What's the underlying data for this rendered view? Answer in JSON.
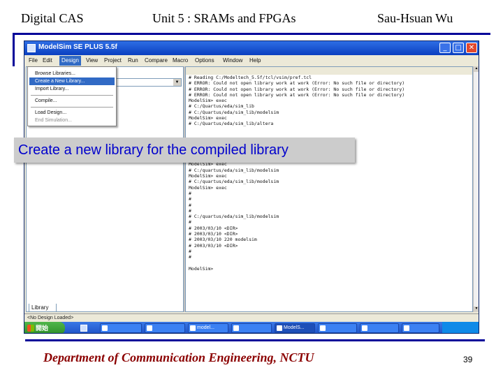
{
  "header": {
    "left": "Digital CAS",
    "center": "Unit 5 : SRAMs and FPGAs",
    "right": "Sau-Hsuan Wu"
  },
  "window": {
    "title": "ModelSim SE PLUS 5.5f",
    "controls": {
      "minimize": "_",
      "maximize": "□",
      "close": "✕"
    }
  },
  "menubar": [
    "File",
    "Edit",
    "Design",
    "View",
    "Project",
    "Run",
    "Compare",
    "Macro",
    "Options",
    "Window",
    "Help"
  ],
  "dropdown": {
    "items": [
      {
        "label": "Browse Libraries...",
        "state": "normal"
      },
      {
        "label": "Create a New Library...",
        "state": "selected"
      },
      {
        "label": "Import Library...",
        "state": "normal"
      },
      {
        "label": "Compile...",
        "state": "normal"
      },
      {
        "label": "Load Design...",
        "state": "normal"
      },
      {
        "label": "End Simulation...",
        "state": "disabled"
      }
    ]
  },
  "left_pane": {
    "tab_label": "Library"
  },
  "transcript": {
    "lines": [
      "# Reading C:/Modeltech_5.5f/tcl/vsim/pref.tcl",
      "# ERROR: Could not open library work at work (Error: No such file or directory)",
      "# ERROR: Could not open library work at work (Error: No such file or directory)",
      "# ERROR: Could not open library work at work (Error: No such file or directory)",
      "ModelSim> exec",
      "# C:/Quartus/eda/sim_lib",
      "# C:/Quartus/eda/sim_lib/modelsim",
      "ModelSim> exec",
      "# C:/Quartus/eda/sim_lib/altera",
      "",
      "",
      "",
      "",
      "",
      "",
      "ModelSim> exec",
      "# C:/quartus/eda/sim_lib/modelsim",
      "ModelSim> exec",
      "# C:/quartus/eda/sim_lib/modelsim",
      "ModelSim> exec",
      "#",
      "#",
      "#",
      "#",
      "# C:/quartus/eda/sim_lib/modelsim",
      "#",
      "# 2003/03/10 <DIR>",
      "# 2003/03/10 <DIR>",
      "# 2003/03/10 220 modelsim",
      "# 2003/03/10 <DIR>",
      "#",
      "#",
      "",
      "ModelSim>"
    ]
  },
  "prompt": "<No Design Loaded>",
  "taskbar": {
    "start_label": "開始",
    "tasks": [
      {
        "label": ""
      },
      {
        "label": ""
      },
      {
        "label": "model..."
      },
      {
        "label": ""
      },
      {
        "label": "ModelS..."
      },
      {
        "label": ""
      },
      {
        "label": ""
      },
      {
        "label": ""
      }
    ],
    "tray": ""
  },
  "callout": "Create a  new library for the compiled library",
  "footer": {
    "department": "Department of Communication Engineering, NCTU",
    "page": "39"
  },
  "colors": {
    "rule": "#000099",
    "footer_text": "#8b0000",
    "callout_text": "#0000cc",
    "callout_bg": "#cccccc",
    "xp_blue": "#0a3fc0",
    "menu_highlight": "#316ac5"
  }
}
